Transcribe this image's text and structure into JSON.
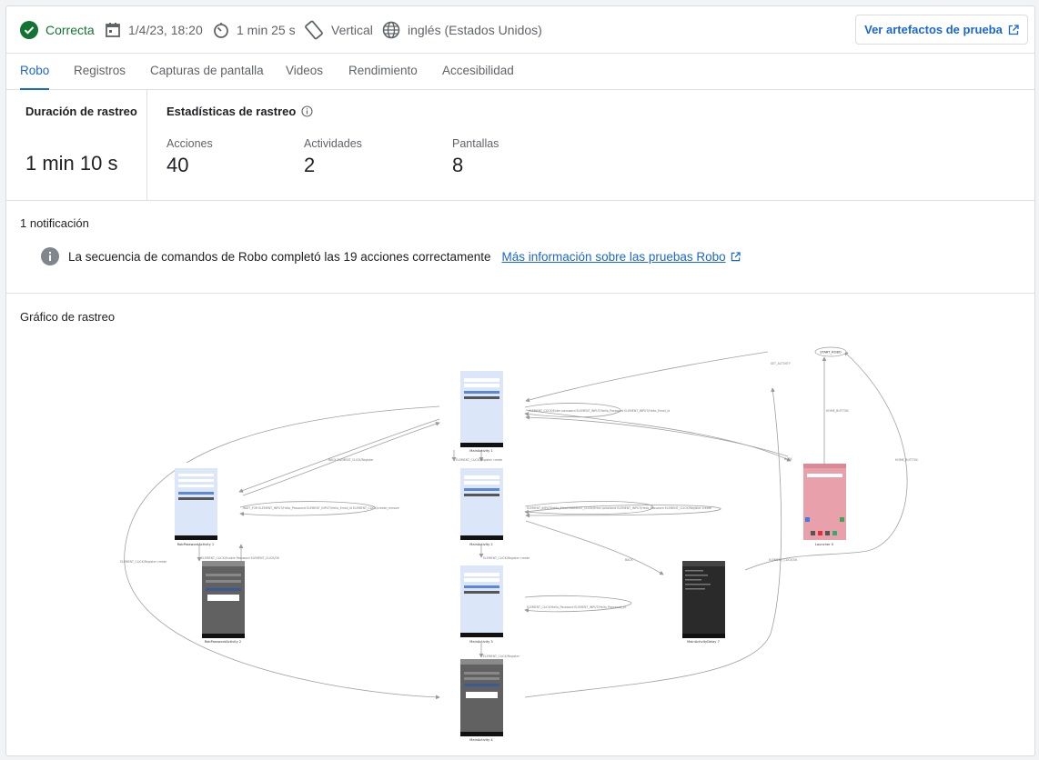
{
  "header": {
    "status_label": "Correcta",
    "date": "1/4/23, 18:20",
    "duration": "1 min 25 s",
    "orientation": "Vertical",
    "locale": "inglés (Estados Unidos)",
    "artifacts_button": "Ver artefactos de prueba"
  },
  "tabs": [
    {
      "label": "Robo"
    },
    {
      "label": "Registros"
    },
    {
      "label": "Capturas de pantalla"
    },
    {
      "label": "Videos"
    },
    {
      "label": "Rendimiento"
    },
    {
      "label": "Accesibilidad"
    }
  ],
  "crawl": {
    "duration_title": "Duración de rastreo",
    "duration_value": "1 min 10 s",
    "stats_title": "Estadísticas de rastreo",
    "actions_label": "Acciones",
    "actions_value": "40",
    "activities_label": "Actividades",
    "activities_value": "2",
    "screens_label": "Pantallas",
    "screens_value": "8"
  },
  "notifications": {
    "title": "1 notificación",
    "message": "La secuencia de comandos de Robo completó las 19 acciones correctamente",
    "link": "Más información sobre las pruebas Robo"
  },
  "graph": {
    "title": "Gráfico de rastreo",
    "nodes": [
      {
        "label": "MainActivity 1"
      },
      {
        "label": "MainActivity 2"
      },
      {
        "label": "MainActivity 3"
      },
      {
        "label": "MainActivity 4"
      },
      {
        "label": "RobPasswordActivity 1"
      },
      {
        "label": "RobPasswordActivity 2"
      },
      {
        "label": "Launcher 0"
      },
      {
        "label": "MainActivityDelay 7"
      }
    ],
    "start_node": "START_ROBO"
  },
  "colors": {
    "accent": "#1967d2",
    "success": "#137333",
    "info_icon": "#5f6368"
  }
}
